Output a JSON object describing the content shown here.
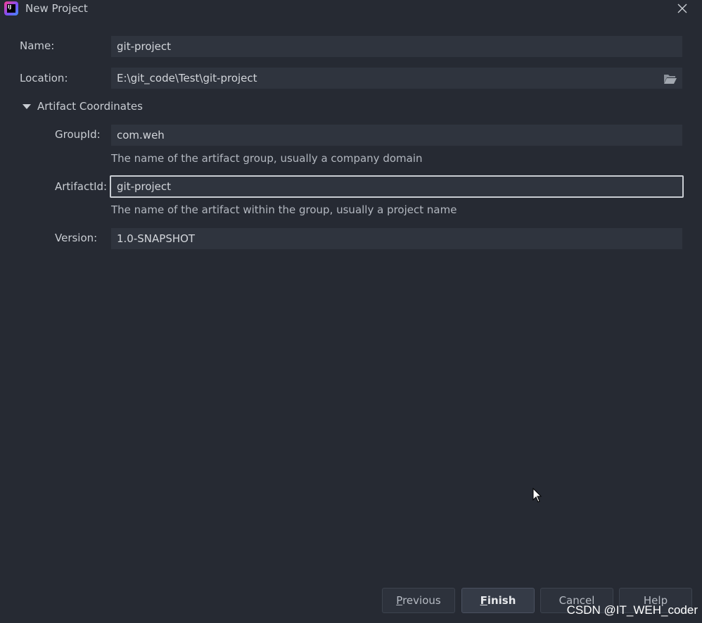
{
  "window": {
    "title": "New Project",
    "app_icon": "intellij-idea-icon",
    "close_icon": "close-icon"
  },
  "form": {
    "name": {
      "label": "Name:",
      "value": "git-project"
    },
    "location": {
      "label": "Location:",
      "value": "E:\\git_code\\Test\\git-project",
      "icon": "folder-icon"
    },
    "section": {
      "label": "Artifact Coordinates",
      "expanded": true,
      "icon": "triangle-down-icon"
    },
    "group_id": {
      "label": "GroupId:",
      "value": "com.weh",
      "hint": "The name of the artifact group, usually a company domain"
    },
    "artifact_id": {
      "label": "ArtifactId:",
      "value": "git-project",
      "hint": "The name of the artifact within the group, usually a project name",
      "focused": true
    },
    "version": {
      "label": "Version:",
      "value": "1.0-SNAPSHOT"
    }
  },
  "buttons": {
    "previous": {
      "mnemonic": "P",
      "rest": "revious"
    },
    "finish": {
      "mnemonic": "F",
      "rest": "inish"
    },
    "cancel": {
      "label": "Cancel"
    },
    "help": {
      "label": "Help"
    }
  },
  "watermark": "CSDN @IT_WEH_coder",
  "colors": {
    "background": "#262a33",
    "field": "#2f343e",
    "text": "#c9cdd3",
    "focus_border": "#c9cdd3"
  }
}
